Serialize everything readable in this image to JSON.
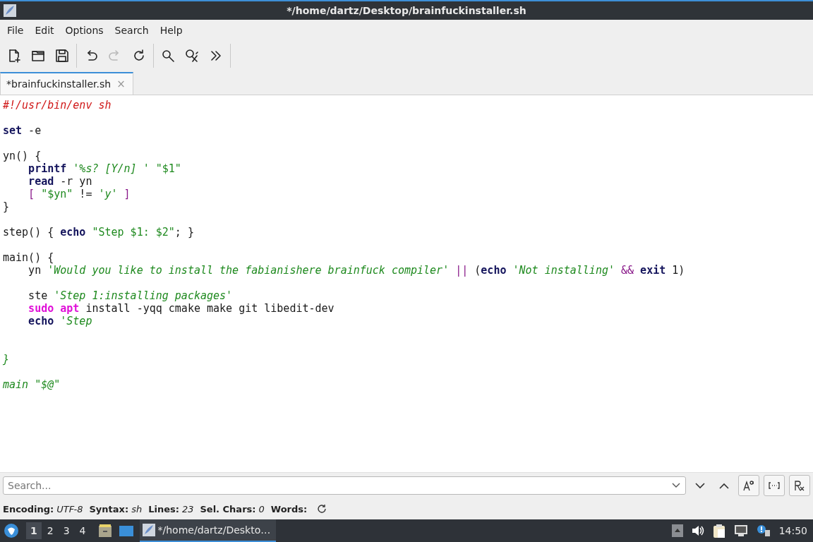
{
  "window": {
    "title": "*/home/dartz/Desktop/brainfuckinstaller.sh"
  },
  "menu": [
    "File",
    "Edit",
    "Options",
    "Search",
    "Help"
  ],
  "toolbar": [
    {
      "buttons": [
        {
          "kind": "new",
          "disabled": false
        },
        {
          "kind": "open",
          "disabled": false
        },
        {
          "kind": "save",
          "disabled": false
        }
      ]
    },
    {
      "buttons": [
        {
          "kind": "undo",
          "disabled": false
        },
        {
          "kind": "redo",
          "disabled": true
        },
        {
          "kind": "reload",
          "disabled": false
        }
      ]
    },
    {
      "buttons": [
        {
          "kind": "find",
          "disabled": false
        },
        {
          "kind": "replace",
          "disabled": false
        },
        {
          "kind": "more",
          "disabled": false
        }
      ]
    }
  ],
  "tabs": [
    {
      "label": "*brainfuckinstaller.sh",
      "selected": true,
      "close": "×"
    }
  ],
  "code": [
    {
      "kind": "code",
      "tokens": [
        {
          "kind": "comment",
          "s": "#!/usr/bin/env sh"
        }
      ]
    },
    {
      "kind": "blank"
    },
    {
      "kind": "code",
      "tokens": [
        {
          "kind": "keyword",
          "s": "set"
        },
        {
          "kind": "plain",
          "s": " -e"
        }
      ]
    },
    {
      "kind": "blank"
    },
    {
      "kind": "code",
      "tokens": [
        {
          "kind": "plain",
          "s": "yn() {"
        }
      ]
    },
    {
      "kind": "code",
      "tokens": [
        {
          "kind": "keyword",
          "s": "    printf"
        },
        {
          "kind": "string",
          "s": " '%s? [Y/n] '"
        },
        {
          "kind": "dquote",
          "s": " \"$1\""
        }
      ]
    },
    {
      "kind": "code",
      "tokens": [
        {
          "kind": "keyword",
          "s": "    read"
        },
        {
          "kind": "plain",
          "s": " -r yn"
        }
      ]
    },
    {
      "kind": "code",
      "tokens": [
        {
          "kind": "operator",
          "s": "    ["
        },
        {
          "kind": "dquote",
          "s": " \"$yn\""
        },
        {
          "kind": "plain",
          "s": " != "
        },
        {
          "kind": "string",
          "s": "'y'"
        },
        {
          "kind": "operator",
          "s": " ]"
        }
      ]
    },
    {
      "kind": "code",
      "tokens": [
        {
          "kind": "plain",
          "s": "}"
        }
      ]
    },
    {
      "kind": "blank"
    },
    {
      "kind": "code",
      "tokens": [
        {
          "kind": "plain",
          "s": "step() { "
        },
        {
          "kind": "keyword",
          "s": "echo"
        },
        {
          "kind": "dquote",
          "s": " \"Step $1: $2\""
        },
        {
          "kind": "plain",
          "s": "; }"
        }
      ]
    },
    {
      "kind": "blank"
    },
    {
      "kind": "code",
      "tokens": [
        {
          "kind": "plain",
          "s": "main() {"
        }
      ]
    },
    {
      "kind": "code",
      "tokens": [
        {
          "kind": "plain",
          "s": "    yn "
        },
        {
          "kind": "string",
          "s": "'Would you like to install the fabianishere brainfuck compiler'"
        },
        {
          "kind": "operator",
          "s": " ||"
        },
        {
          "kind": "plain",
          "s": " ("
        },
        {
          "kind": "keyword",
          "s": "echo"
        },
        {
          "kind": "string",
          "s": " 'Not installing'"
        },
        {
          "kind": "operator",
          "s": " &&"
        },
        {
          "kind": "keyword",
          "s": " exit"
        },
        {
          "kind": "plain",
          "s": " 1)"
        }
      ]
    },
    {
      "kind": "blank"
    },
    {
      "kind": "code",
      "tokens": [
        {
          "kind": "plain",
          "s": "    ste "
        },
        {
          "kind": "string",
          "s": "'Step 1:installing packages'"
        }
      ]
    },
    {
      "kind": "code",
      "tokens": [
        {
          "kind": "command",
          "s": "    sudo"
        },
        {
          "kind": "command",
          "s": " apt"
        },
        {
          "kind": "plain",
          "s": " install -yqq cmake make git libedit-dev"
        }
      ]
    },
    {
      "kind": "code",
      "tokens": [
        {
          "kind": "keyword",
          "s": "    echo"
        },
        {
          "kind": "string",
          "s": " 'Step"
        }
      ]
    },
    {
      "kind": "blank"
    },
    {
      "kind": "blank"
    },
    {
      "kind": "code",
      "tokens": [
        {
          "kind": "string",
          "s": "}"
        }
      ]
    },
    {
      "kind": "blank"
    },
    {
      "kind": "code",
      "tokens": [
        {
          "kind": "string",
          "s": "main \"$@\""
        }
      ]
    }
  ],
  "search": {
    "placeholder": "Search...",
    "buttons": [
      {
        "kind": "case"
      },
      {
        "kind": "whole"
      },
      {
        "kind": "regex"
      }
    ]
  },
  "status_bar": [
    {
      "label": "Encoding:",
      "value": "UTF-8"
    },
    {
      "label": "Syntax:",
      "value": "sh"
    },
    {
      "label": "Lines:",
      "value": "23"
    },
    {
      "label": "Sel. Chars:",
      "value": "0"
    },
    {
      "label": "Words:"
    }
  ],
  "taskbar": {
    "workspaces": [
      {
        "label": "1",
        "selected": true
      },
      {
        "label": "2",
        "selected": false
      },
      {
        "label": "3",
        "selected": false
      },
      {
        "label": "4",
        "selected": false
      }
    ],
    "tasks": [
      {
        "label": "*/home/dartz/Deskto…",
        "selected": true
      }
    ],
    "clock": "14:50"
  }
}
